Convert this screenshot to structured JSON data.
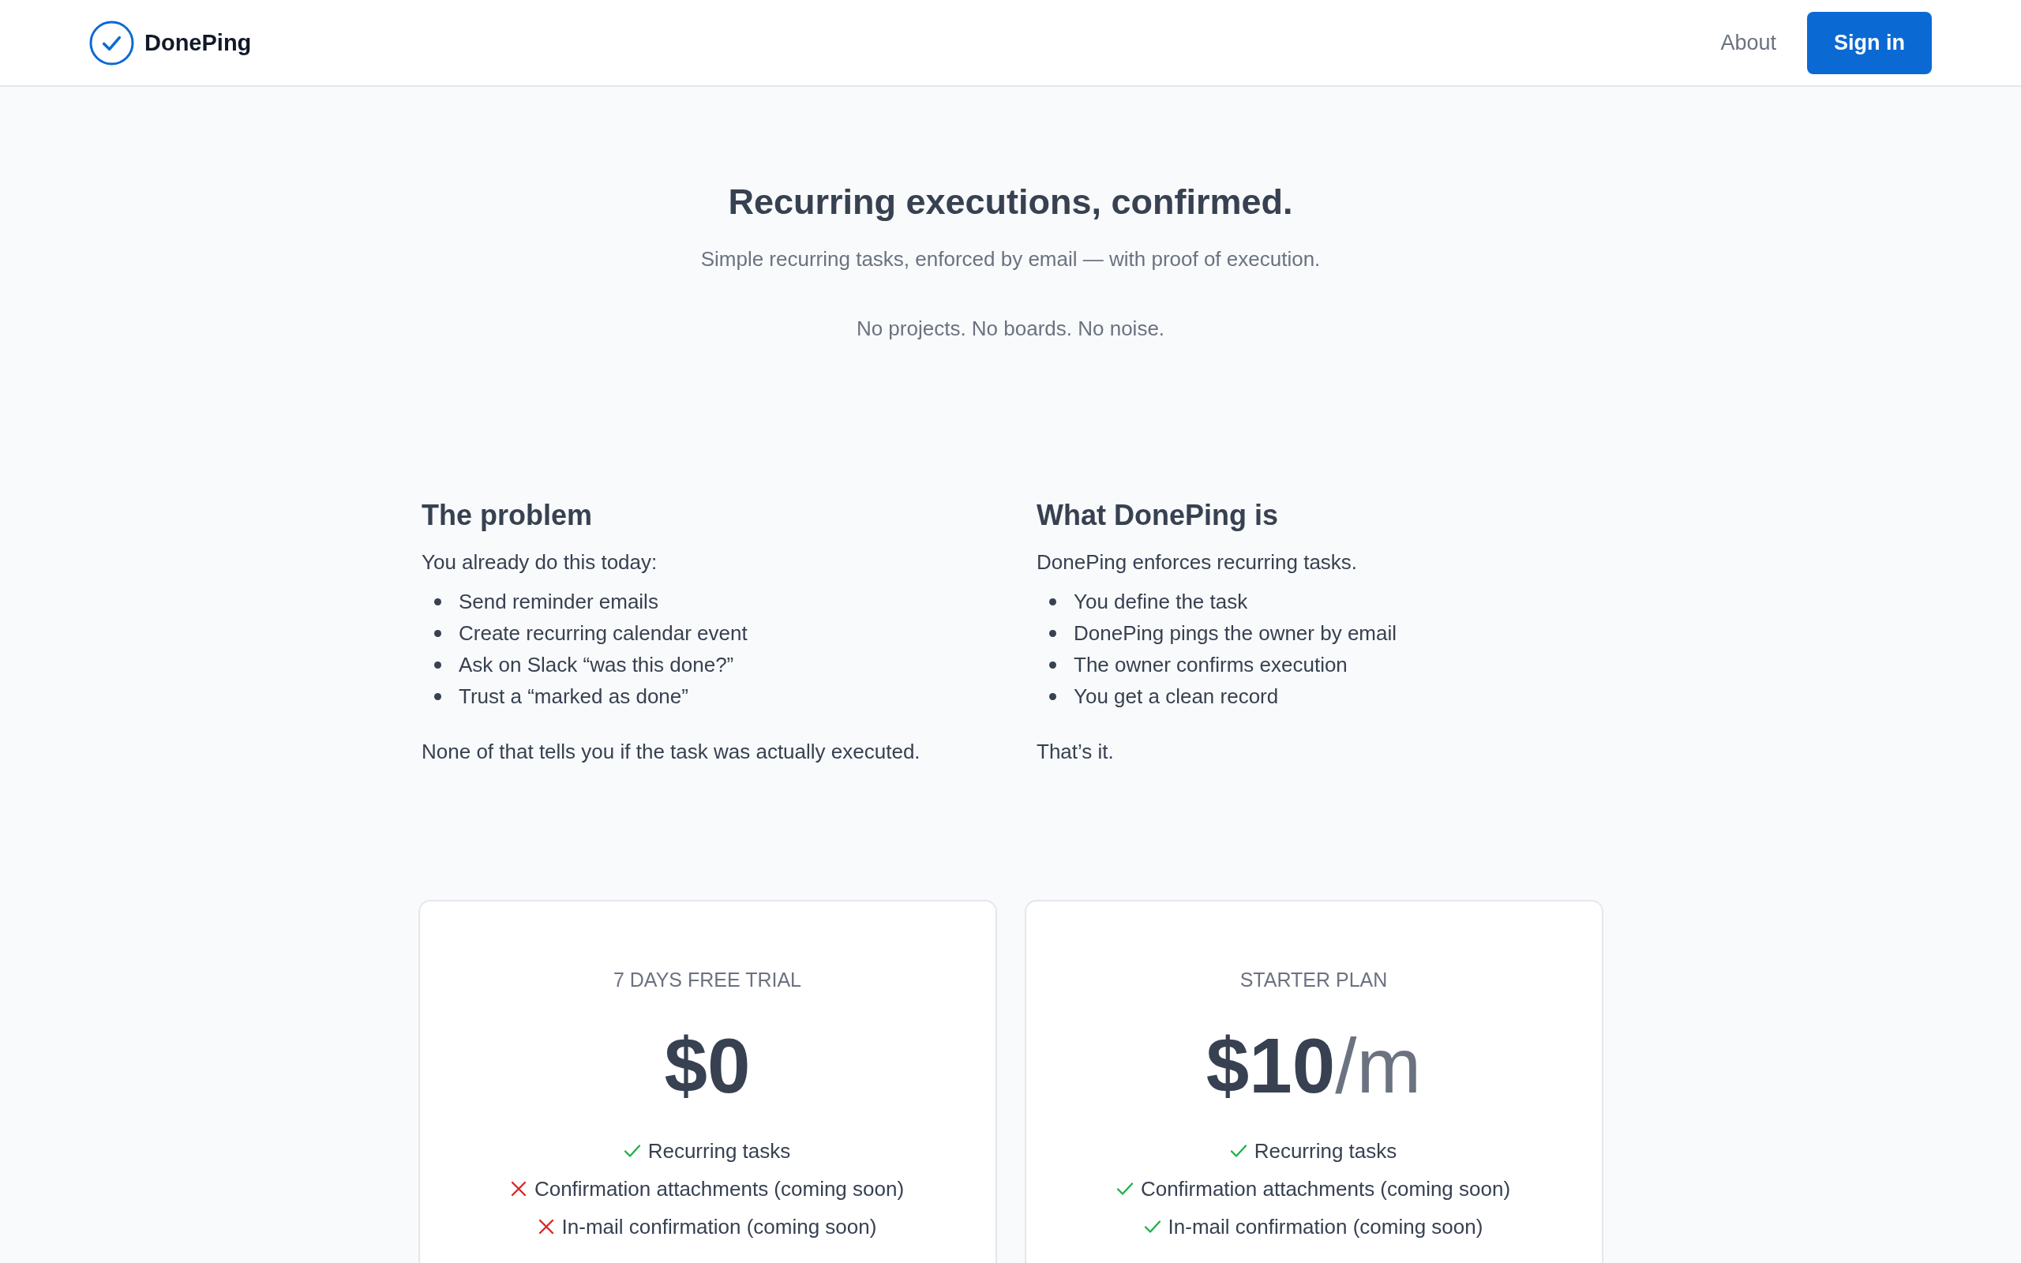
{
  "header": {
    "brand": "DonePing",
    "nav": [
      {
        "label": "About",
        "kind": "link"
      },
      {
        "label": "Sign in",
        "kind": "button"
      }
    ]
  },
  "hero": {
    "title": "Recurring executions, confirmed.",
    "subtitle": "Simple recurring tasks, enforced by email — with proof of execution.",
    "tagline": "No projects. No boards. No noise."
  },
  "sections": [
    {
      "heading": "The problem",
      "intro": "You already do this today:",
      "items": [
        "Send reminder emails",
        "Create recurring calendar event",
        "Ask on Slack “was this done?”",
        "Trust a “marked as done”"
      ],
      "outro": "None of that tells you if the task was actually executed."
    },
    {
      "heading": "What DonePing is",
      "intro": "DonePing enforces recurring tasks.",
      "items": [
        "You define the task",
        "DonePing pings the owner by email",
        "The owner confirms execution",
        "You get a clean record"
      ],
      "outro": "That’s it."
    }
  ],
  "plans": [
    {
      "name": "7 DAYS FREE TRIAL",
      "price": "$0",
      "features": [
        {
          "label": "Recurring tasks",
          "included": true
        },
        {
          "label": "Confirmation attachments (coming soon)",
          "included": false
        },
        {
          "label": "In-mail confirmation (coming soon)",
          "included": false
        }
      ]
    },
    {
      "name": "STARTER PLAN",
      "price": "$10",
      "period": "/m",
      "features": [
        {
          "label": "Recurring tasks",
          "included": true
        },
        {
          "label": "Confirmation attachments (coming soon)",
          "included": true
        },
        {
          "label": "In-mail confirmation (coming soon)",
          "included": true
        }
      ]
    }
  ]
}
